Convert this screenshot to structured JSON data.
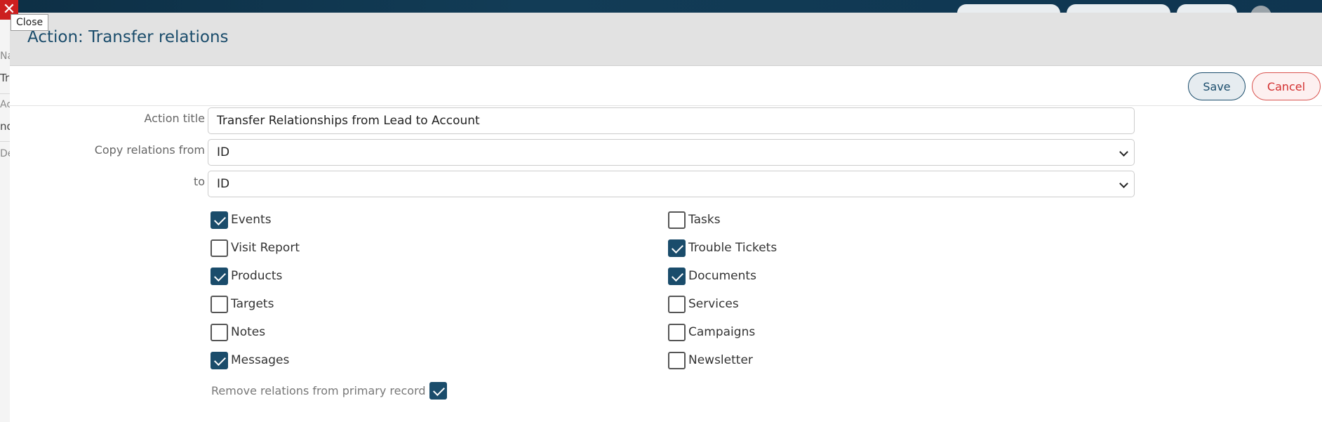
{
  "colors": {
    "accent": "#1a4c6b",
    "cancel": "#d32f2f",
    "header_bg": "#e2e2e2"
  },
  "close_tooltip": "Close",
  "background": {
    "left_labels": [
      "Na",
      "Tr",
      "Ac",
      "nd",
      "De"
    ]
  },
  "modal": {
    "title": "Action: Transfer relations",
    "save_label": "Save",
    "cancel_label": "Cancel",
    "action_title_label": "Action title",
    "action_title_value": "Transfer Relationships from Lead to Account",
    "copy_from_label": "Copy relations from",
    "copy_from_value": "ID",
    "to_label": "to",
    "to_value": "ID",
    "relations": [
      {
        "label": "Events",
        "checked": true
      },
      {
        "label": "Tasks",
        "checked": false
      },
      {
        "label": "Visit Report",
        "checked": false
      },
      {
        "label": "Trouble Tickets",
        "checked": true
      },
      {
        "label": "Products",
        "checked": true
      },
      {
        "label": "Documents",
        "checked": true
      },
      {
        "label": "Targets",
        "checked": false
      },
      {
        "label": "Services",
        "checked": false
      },
      {
        "label": "Notes",
        "checked": false
      },
      {
        "label": "Campaigns",
        "checked": false
      },
      {
        "label": "Messages",
        "checked": true
      },
      {
        "label": "Newsletter",
        "checked": false
      }
    ],
    "remove_relations_label": "Remove relations from primary record",
    "remove_relations_checked": true
  }
}
